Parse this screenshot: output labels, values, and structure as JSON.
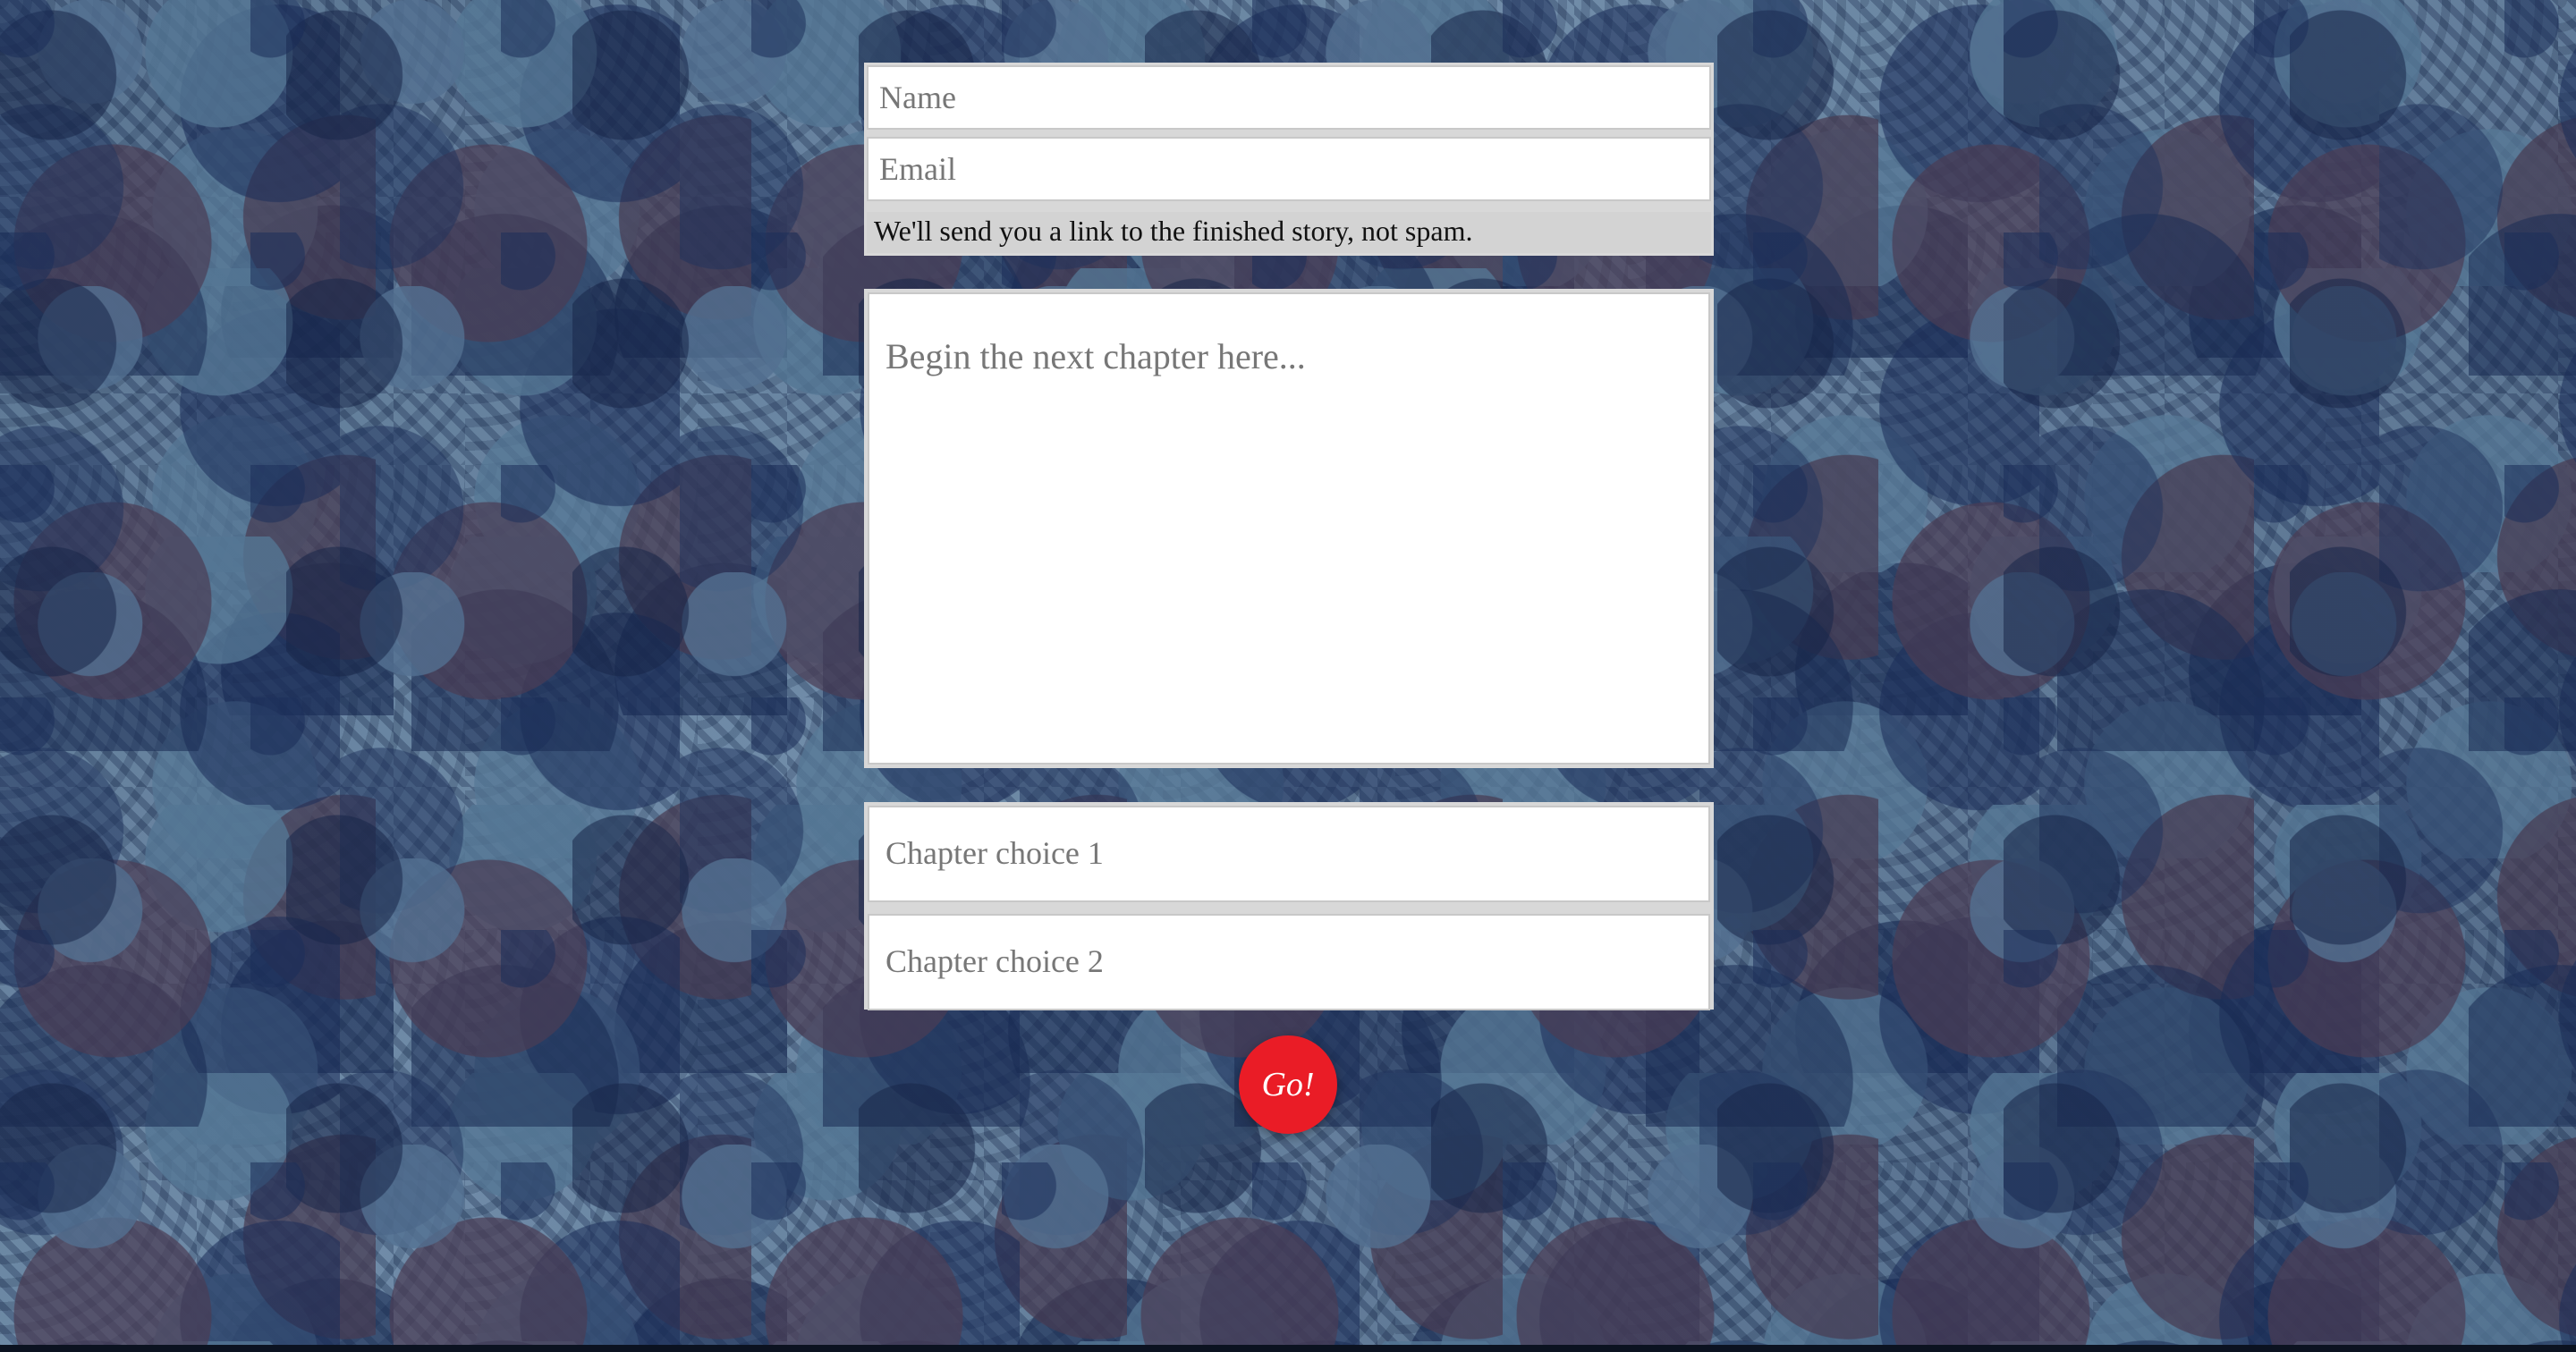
{
  "form": {
    "name_placeholder": "Name",
    "email_placeholder": "Email",
    "email_note": "We'll send you a link to the finished story, not spam.",
    "story_placeholder": "Begin the next chapter here...",
    "choice_1_placeholder": "Chapter choice 1",
    "choice_2_placeholder": "Chapter choice 2",
    "submit_label": "Go!"
  },
  "colors": {
    "button": "#ea1c26",
    "helper_background": "#d3d3d3"
  }
}
